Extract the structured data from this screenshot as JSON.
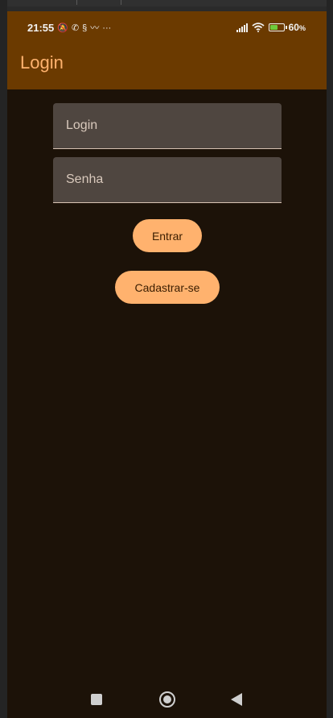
{
  "status_bar": {
    "time": "21:55",
    "battery_percent": "60",
    "battery_suffix": "%",
    "battery_level": 0.6,
    "notification_icons": [
      "muted-bell-icon",
      "whatsapp-icon",
      "app-icon",
      "bird-icon",
      "more-dots-icon"
    ],
    "system_icons": [
      "signal-icon",
      "wifi-icon",
      "battery-charging-icon"
    ]
  },
  "app_bar": {
    "title": "Login"
  },
  "form": {
    "login_placeholder": "Login",
    "login_value": "",
    "password_placeholder": "Senha",
    "password_value": "",
    "submit_label": "Entrar",
    "register_label": "Cadastrar-se"
  },
  "nav_bar": {
    "buttons": [
      "recents-button",
      "home-button",
      "back-button"
    ]
  },
  "colors": {
    "app_bar": "#6b3a00",
    "background": "#1c1208",
    "accent": "#ffb26e",
    "field_bg": "#4f4640"
  }
}
